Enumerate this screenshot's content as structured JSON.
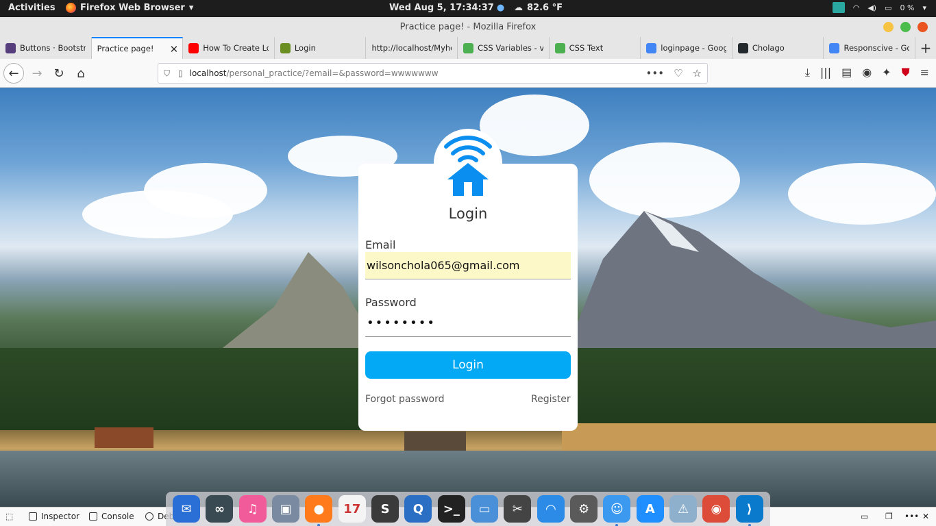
{
  "topbar": {
    "activities": "Activities",
    "app_menu": "Firefox Web Browser",
    "clock": "Wed Aug  5, 17:34:37",
    "weather": "82.6 °F",
    "battery": "0 %"
  },
  "window": {
    "title": "Practice page! - Mozilla Firefox"
  },
  "tabs": [
    {
      "label": "Buttons · Bootstra",
      "icon": "bootstrap-icon",
      "color": "#563d7c"
    },
    {
      "label": "Practice page!",
      "icon": "",
      "active": true
    },
    {
      "label": "How To Create Lo",
      "icon": "youtube-icon",
      "color": "#ff0000"
    },
    {
      "label": "Login",
      "icon": "wifi-home-icon",
      "color": "#6b8e23"
    },
    {
      "label": "http://localhost/Myho",
      "icon": ""
    },
    {
      "label": "CSS Variables - var",
      "icon": "w3schools-icon",
      "color": "#4caf50"
    },
    {
      "label": "CSS Text",
      "icon": "w3schools-icon",
      "color": "#4caf50"
    },
    {
      "label": "loginpage - Googl",
      "icon": "google-icon",
      "color": "#4285f4"
    },
    {
      "label": "Cholago",
      "icon": "github-icon",
      "color": "#24292e"
    },
    {
      "label": "Responscive - Goo",
      "icon": "google-icon",
      "color": "#4285f4"
    }
  ],
  "urlbar": {
    "host": "localhost",
    "path": "/personal_practice/?email=&password=wwwwwww"
  },
  "login": {
    "title": "Login",
    "email_label": "Email",
    "email_value": "wilsonchola065@gmail.com",
    "password_label": "Password",
    "password_value": "••••••••",
    "button": "Login",
    "forgot": "Forgot password",
    "register": "Register",
    "accent_color": "#03a9f4"
  },
  "devtools": {
    "inspector": "Inspector",
    "console": "Console",
    "debugger": "Deb"
  },
  "dock": [
    {
      "name": "thunderbird-icon",
      "color": "#2a6fd6",
      "glyph": "✉"
    },
    {
      "name": "arduino-icon",
      "color": "#3a4a52",
      "glyph": "∞"
    },
    {
      "name": "music-icon",
      "color": "#f25b9a",
      "glyph": "♫"
    },
    {
      "name": "image-viewer-icon",
      "color": "#7a8aa0",
      "glyph": "▣"
    },
    {
      "name": "firefox-icon",
      "color": "#ff7a1a",
      "glyph": "●",
      "running": true
    },
    {
      "name": "calendar-icon",
      "color": "#f4f4f4",
      "glyph": "17"
    },
    {
      "name": "sublime-text-icon",
      "color": "#3a3a3a",
      "glyph": "S"
    },
    {
      "name": "search-app-icon",
      "color": "#2b6fc4",
      "glyph": "Q"
    },
    {
      "name": "terminal-icon",
      "color": "#222",
      "glyph": ">_"
    },
    {
      "name": "files-icon",
      "color": "#4a90d9",
      "glyph": "▭"
    },
    {
      "name": "screenshot-icon",
      "color": "#444",
      "glyph": "✂"
    },
    {
      "name": "network-icon",
      "color": "#2b8be6",
      "glyph": "◠"
    },
    {
      "name": "settings-icon",
      "color": "#5a5a5a",
      "glyph": "⚙"
    },
    {
      "name": "finder-icon",
      "color": "#3b9af0",
      "glyph": "☺",
      "running": true
    },
    {
      "name": "app-store-icon",
      "color": "#1f8fff",
      "glyph": "A"
    },
    {
      "name": "update-warning-icon",
      "color": "#8fb0cc",
      "glyph": "⚠"
    },
    {
      "name": "chrome-icon",
      "color": "#dd4b39",
      "glyph": "◉"
    },
    {
      "name": "vscode-icon",
      "color": "#0a7acc",
      "glyph": "⟩",
      "running": true
    }
  ]
}
